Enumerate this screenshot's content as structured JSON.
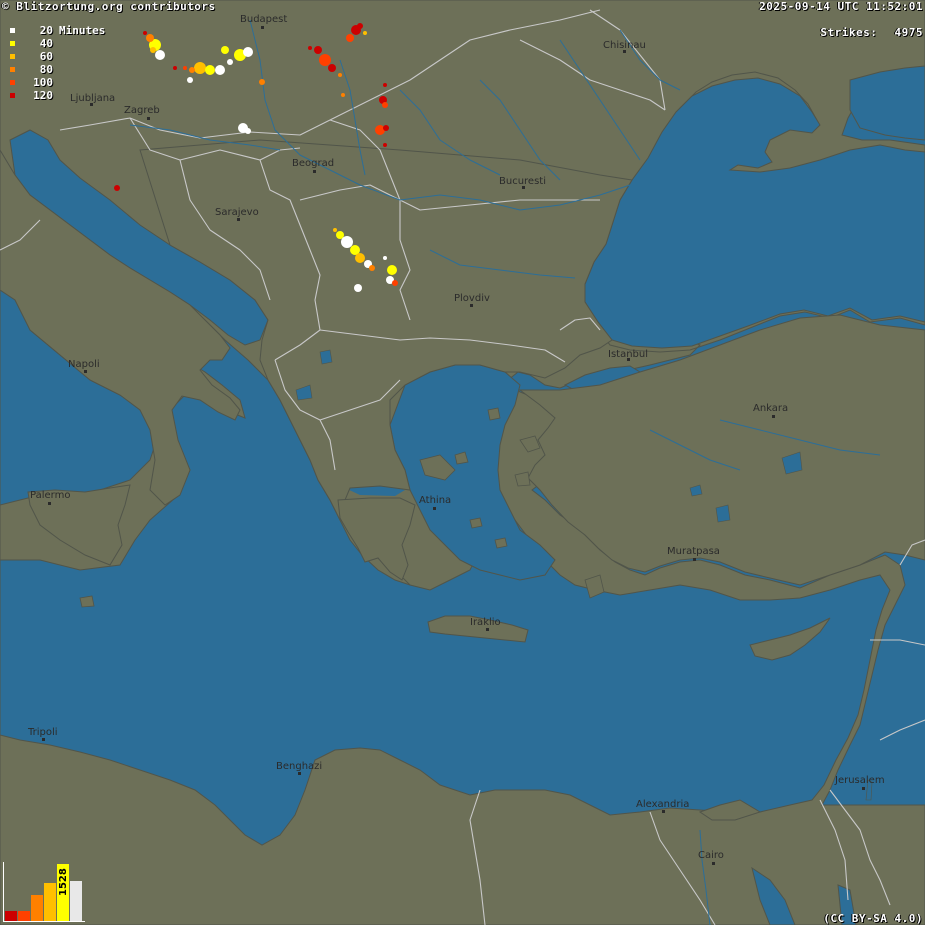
{
  "header": {
    "credit": "© Blitzortung.org contributors",
    "timestamp": "2025-09-14 UTC 11:52:01",
    "strikes_label": "Strikes:",
    "strikes_count": "4975"
  },
  "legend": {
    "items": [
      {
        "value": "20",
        "unit": "Minutes",
        "color": "#ffffff"
      },
      {
        "value": "40",
        "unit": "",
        "color": "#ffff00"
      },
      {
        "value": "60",
        "unit": "",
        "color": "#ffbf00"
      },
      {
        "value": "80",
        "unit": "",
        "color": "#ff8000"
      },
      {
        "value": "100",
        "unit": "",
        "color": "#ff4000"
      },
      {
        "value": "120",
        "unit": "",
        "color": "#cc0000"
      }
    ]
  },
  "cities": [
    {
      "name": "Budapest",
      "id": "budapest"
    },
    {
      "name": "Chisinau",
      "id": "chisinau"
    },
    {
      "name": "Ljubljana",
      "id": "ljubljana"
    },
    {
      "name": "Zagreb",
      "id": "zagreb"
    },
    {
      "name": "Beograd",
      "id": "beograd"
    },
    {
      "name": "Bucuresti",
      "id": "bucuresti"
    },
    {
      "name": "Sarajevo",
      "id": "sarajevo"
    },
    {
      "name": "Plovdiv",
      "id": "plovdiv"
    },
    {
      "name": "Istanbul",
      "id": "istanbul"
    },
    {
      "name": "Ankara",
      "id": "ankara"
    },
    {
      "name": "Napoli",
      "id": "napoli"
    },
    {
      "name": "Palermo",
      "id": "palermo"
    },
    {
      "name": "Athina",
      "id": "athina"
    },
    {
      "name": "Muratpasa",
      "id": "muratpasa"
    },
    {
      "name": "Iraklio",
      "id": "iraklio"
    },
    {
      "name": "Tripoli",
      "id": "tripoli"
    },
    {
      "name": "Benghazi",
      "id": "benghazi"
    },
    {
      "name": "Alexandria",
      "id": "alexandria"
    },
    {
      "name": "Cairo",
      "id": "cairo"
    },
    {
      "name": "Jerusalem",
      "id": "jerusalem"
    }
  ],
  "histogram": {
    "label": "1528",
    "colors": [
      "#cc0000",
      "#ff4000",
      "#ff8000",
      "#ffbf00",
      "#ffff00",
      "#e8e8e8"
    ],
    "values": [
      10,
      10,
      26,
      38,
      57,
      40
    ]
  },
  "footer": {
    "license": "(CC BY-SA 4.0)"
  },
  "colors": {
    "sea": "#2c6e98",
    "land": "#6d7058",
    "border": "#c8c8c8",
    "river": "#2c6e98"
  }
}
